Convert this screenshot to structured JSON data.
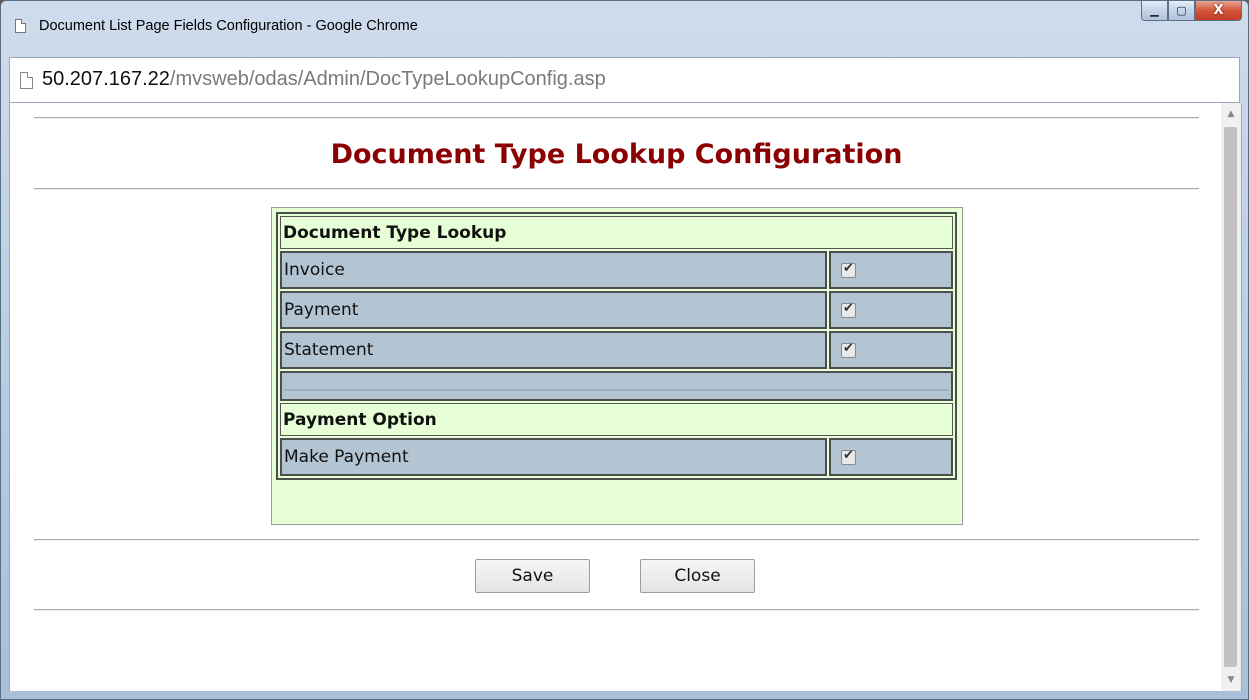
{
  "window": {
    "title": "Document List Page Fields Configuration - Google Chrome",
    "controls": {
      "minimize": "▁",
      "maximize": "▢",
      "close": "X"
    }
  },
  "address": {
    "host": "50.207.167.22",
    "path": "/mvsweb/odas/Admin/DocTypeLookupConfig.asp"
  },
  "page": {
    "title": "Document Type Lookup Configuration"
  },
  "config": {
    "doc_type_header": "Document Type Lookup",
    "doc_types": [
      {
        "label": "Invoice",
        "checked": true
      },
      {
        "label": "Payment",
        "checked": true
      },
      {
        "label": "Statement",
        "checked": true
      }
    ],
    "payment_header": "Payment Option",
    "payment_options": [
      {
        "label": "Make Payment",
        "checked": true
      }
    ],
    "check_glyph": "✔"
  },
  "buttons": {
    "save": "Save",
    "close": "Close"
  },
  "scrollbar": {
    "up": "▲",
    "down": "▼"
  }
}
